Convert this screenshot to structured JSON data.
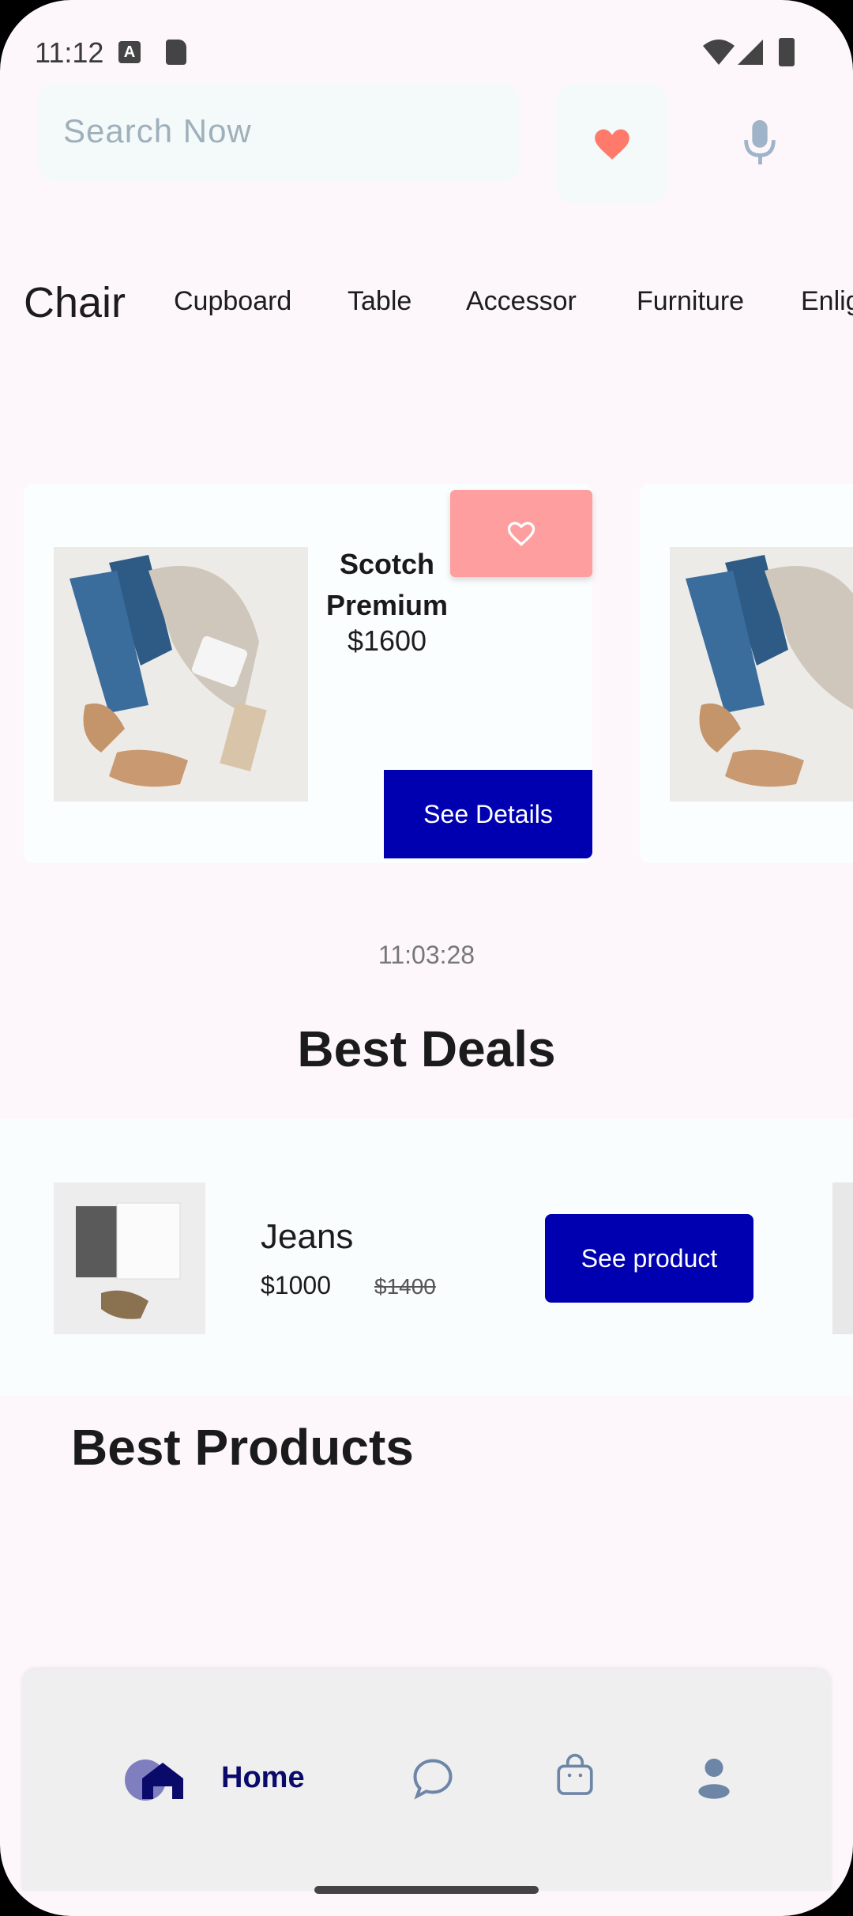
{
  "status_bar": {
    "time": "11:12",
    "a_icon_letter": "A"
  },
  "search": {
    "placeholder": "Search Now"
  },
  "categories": [
    {
      "label": "Chair",
      "active": true
    },
    {
      "label": "Cupboard"
    },
    {
      "label": "Table"
    },
    {
      "label": "Accessor"
    },
    {
      "label": "Furniture"
    },
    {
      "label": "Enlig"
    }
  ],
  "carousel": [
    {
      "name": "Scotch Premium",
      "price": "$1600",
      "button": "See Details"
    }
  ],
  "timer": "11:03:28",
  "best_deals": {
    "title": "Best Deals",
    "item": {
      "name": "Jeans",
      "price": "$1000",
      "old_price": "$1400",
      "button": "See product"
    }
  },
  "best_products": {
    "title": "Best Products"
  },
  "nav": {
    "home_label": "Home",
    "items": [
      "home-icon",
      "chat-icon",
      "bag-icon",
      "profile-icon"
    ]
  },
  "colors": {
    "accent": "#0000b0",
    "heart": "#ff7a6b",
    "heart_button": "#ff9e9e",
    "nav_text": "#0a0a6b"
  }
}
